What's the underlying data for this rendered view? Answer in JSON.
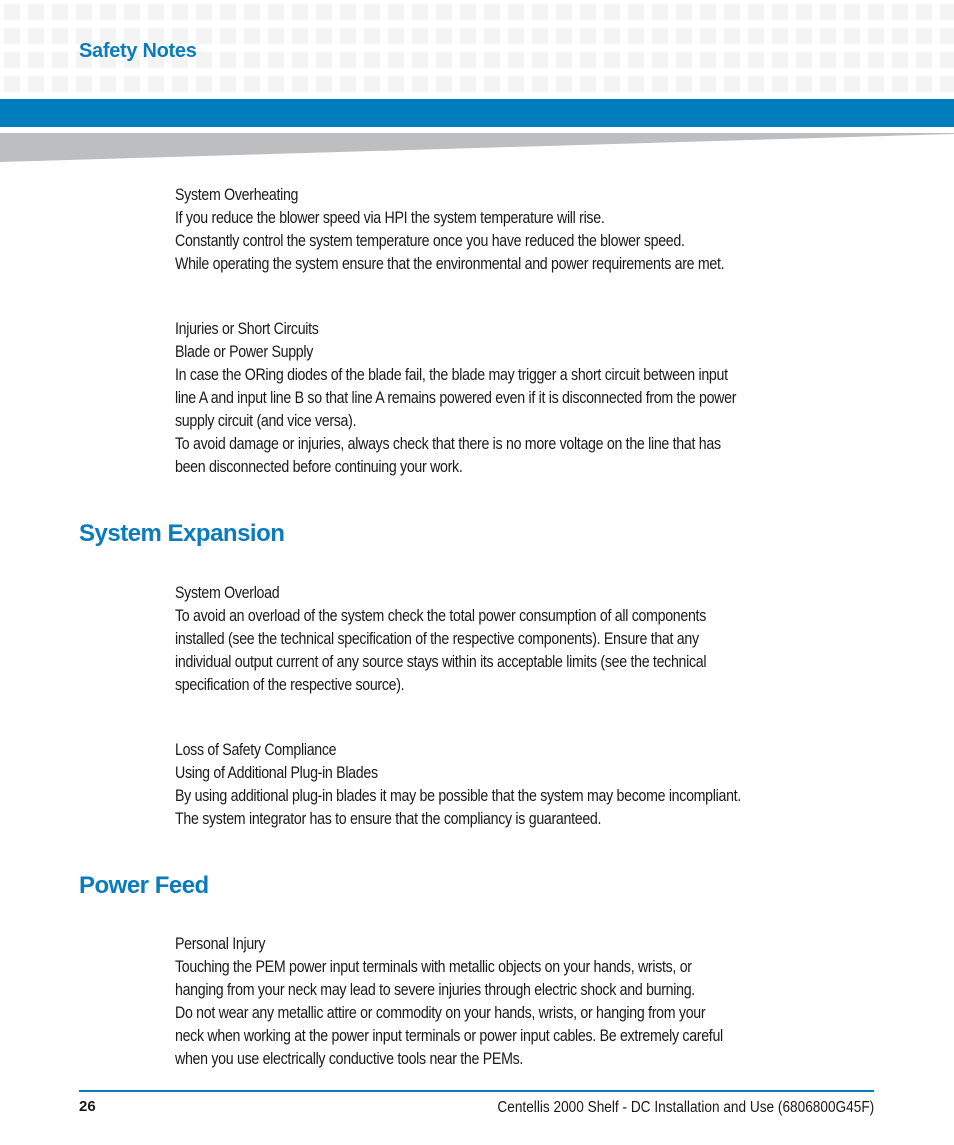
{
  "header": {
    "section_label": "Safety Notes",
    "colors": {
      "accent": "#007dbd",
      "heading": "#0a7bbd",
      "grid": "#f3f3f3",
      "wedge": "#bdbec0"
    }
  },
  "blocks": [
    {
      "type": "notice",
      "lines": [
        "System Overheating",
        "If you reduce the blower speed via HPI the system temperature will rise.",
        "Constantly control the system temperature once you have reduced the blower speed.",
        "While operating the system ensure that the environmental and power requirements are met."
      ]
    },
    {
      "type": "notice",
      "lines": [
        "Injuries or Short Circuits",
        "Blade or Power Supply",
        "In case the ORing diodes of the blade fail, the blade may trigger a short circuit between input",
        "line A and input line B so that line A remains powered even if it is disconnected from the power",
        "supply circuit (and vice versa).",
        "To avoid damage or injuries, always check that there is no more voltage on the line that has",
        "been disconnected before continuing your work."
      ]
    },
    {
      "type": "heading",
      "text": "System Expansion"
    },
    {
      "type": "notice",
      "lines": [
        "System Overload",
        "To avoid an overload of the system check the total power consumption of all components",
        "installed (see the technical specification of the respective components). Ensure that any",
        "individual output current of any source stays within its acceptable limits (see the technical",
        "specification of the respective source)."
      ]
    },
    {
      "type": "notice",
      "lines": [
        "Loss of Safety Compliance",
        "Using of Additional Plug-in Blades",
        "By using additional plug-in blades it may be possible that the system may become incompliant.",
        "The system integrator has to ensure that the compliancy is guaranteed."
      ]
    },
    {
      "type": "heading",
      "text": "Power Feed"
    },
    {
      "type": "notice",
      "lines": [
        "Personal Injury",
        "Touching the PEM power input terminals with metallic objects on your hands, wrists, or",
        "hanging from your neck may lead to severe injuries through electric shock and burning.",
        "Do not wear any metallic attire or commodity on your hands, wrists, or hanging from your",
        "neck when working at the power input terminals or power input cables. Be extremely careful",
        "when you use electrically conductive tools near the PEMs."
      ]
    }
  ],
  "footer": {
    "page_number": "26",
    "document_title": "Centellis 2000 Shelf - DC Installation and Use (6806800G45F)"
  }
}
